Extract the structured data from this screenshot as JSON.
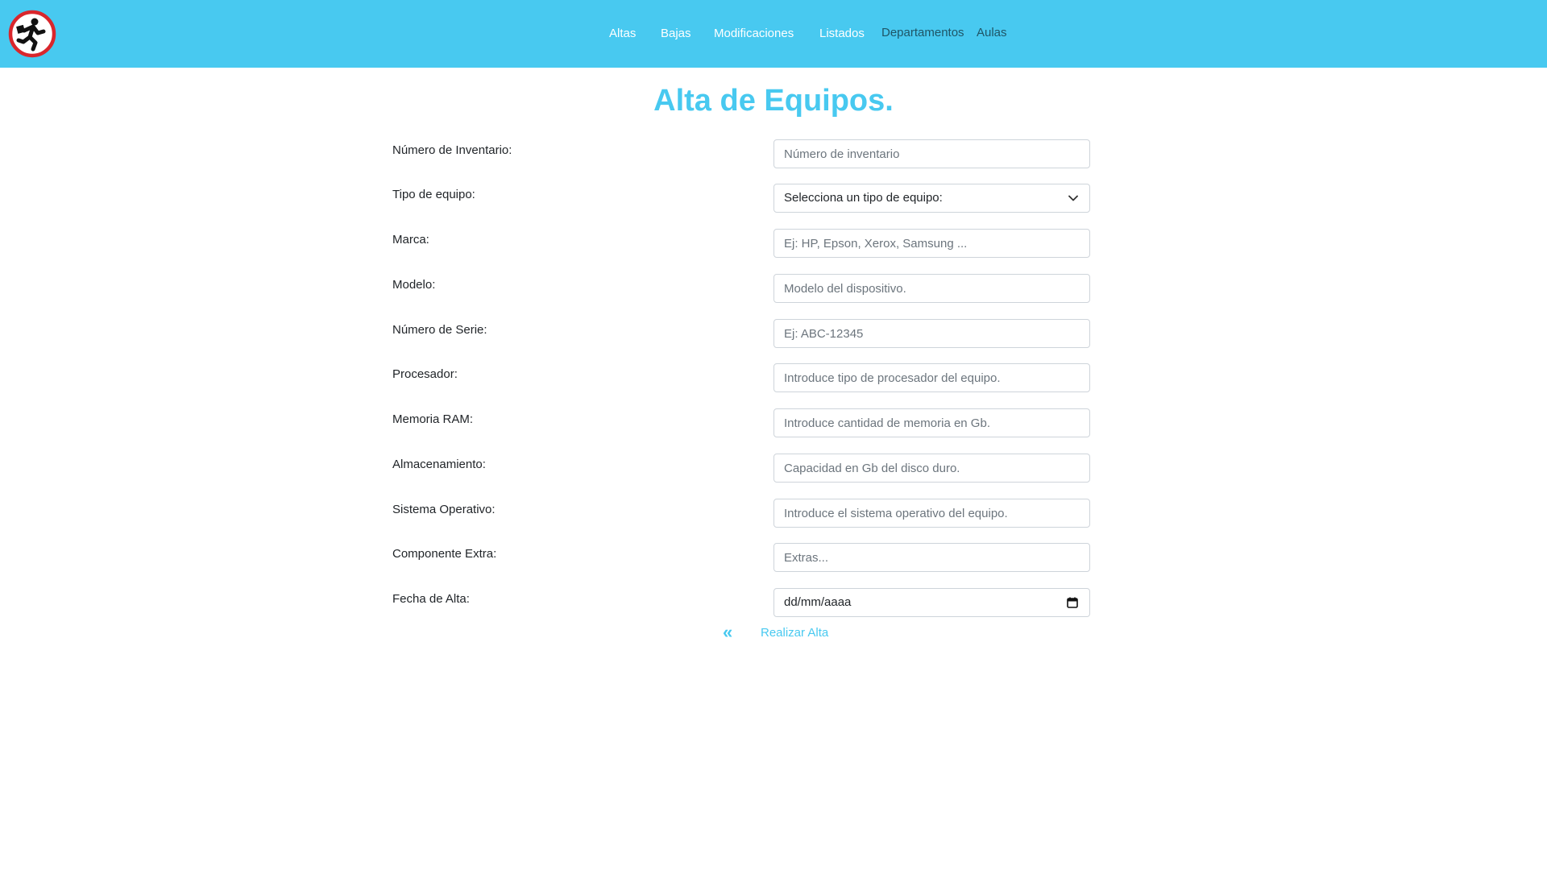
{
  "nav": {
    "logo_icon": "running-man-prohibited-icon",
    "links": [
      {
        "label": "Altas"
      },
      {
        "label": "Bajas"
      },
      {
        "label": "Modificaciones"
      },
      {
        "label": "Listados"
      },
      {
        "label": "Departamentos"
      },
      {
        "label": "Aulas"
      }
    ],
    "color": "#48c9f0"
  },
  "page": {
    "title": "Alta de Equipos."
  },
  "form": {
    "fields": [
      {
        "label": "Número de Inventario:",
        "placeholder": "Número de inventario",
        "value": ""
      },
      {
        "label": "Tipo de equipo:",
        "value": "Selecciona un tipo de equipo:"
      },
      {
        "label": "Marca:",
        "placeholder": "Ej: HP, Epson, Xerox, Samsung ...",
        "value": ""
      },
      {
        "label": "Modelo:",
        "placeholder": "Modelo del dispositivo.",
        "value": ""
      },
      {
        "label": "Número de Serie:",
        "placeholder": "Ej: ABC-12345",
        "value": ""
      },
      {
        "label": "Procesador:",
        "placeholder": "Introduce tipo de procesador del equipo.",
        "value": ""
      },
      {
        "label": "Memoria RAM:",
        "placeholder": "Introduce cantidad de memoria en Gb.",
        "value": ""
      },
      {
        "label": "Almacenamiento:",
        "placeholder": "Capacidad en Gb del disco duro.",
        "value": ""
      },
      {
        "label": "Sistema Operativo:",
        "placeholder": "Introduce el sistema operativo del equipo.",
        "value": ""
      },
      {
        "label": "Componente Extra:",
        "placeholder": "Extras...",
        "value": ""
      },
      {
        "label": "Fecha de Alta:",
        "value": "dd/mm/aaaa"
      }
    ]
  },
  "actions": {
    "back_icon": "double-chevron-left-icon",
    "back_glyph": "«",
    "submit_label": "Realizar Alta"
  }
}
